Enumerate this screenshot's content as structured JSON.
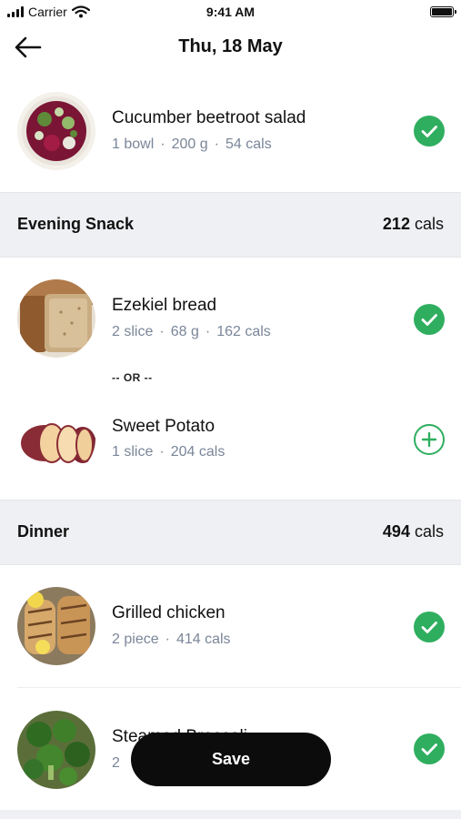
{
  "status_bar": {
    "carrier": "Carrier",
    "time": "9:41 AM"
  },
  "header": {
    "title": "Thu, 18 May"
  },
  "sections": [
    {
      "items": [
        {
          "name": "Cucumber beetroot salad",
          "qty": "1",
          "unit": "bowl",
          "weight": "200",
          "weight_unit": "g",
          "cals": "54",
          "cals_unit": "cals",
          "status": "checked"
        }
      ]
    },
    {
      "title": "Evening Snack",
      "cals": "212",
      "cals_unit": "cals",
      "items": [
        {
          "name": "Ezekiel bread",
          "qty": "2",
          "unit": "slice",
          "weight": "68",
          "weight_unit": "g",
          "cals": "162",
          "cals_unit": "cals",
          "status": "checked"
        },
        {
          "name": "Sweet Potato",
          "qty": "1",
          "unit": "slice",
          "cals": "204",
          "cals_unit": "cals",
          "status": "add"
        }
      ],
      "separator": "-- OR --"
    },
    {
      "title": "Dinner",
      "cals": "494",
      "cals_unit": "cals",
      "items": [
        {
          "name": "Grilled chicken",
          "qty": "2",
          "unit": "piece",
          "cals": "414",
          "cals_unit": "cals",
          "status": "checked"
        },
        {
          "name_visible": "Stea",
          "name_visible_tail": "med Broccoli",
          "qty": "2",
          "status": "checked"
        }
      ]
    }
  ],
  "save_button": {
    "label": "Save"
  },
  "colors": {
    "accent_green": "#2fae5f",
    "section_bg": "#eef0f3",
    "meta_text": "#7a8699",
    "button_bg": "#0c0c0c"
  },
  "icons": [
    "signal-icon",
    "wifi-icon",
    "battery-icon",
    "back-arrow-icon",
    "check-icon",
    "plus-icon"
  ]
}
